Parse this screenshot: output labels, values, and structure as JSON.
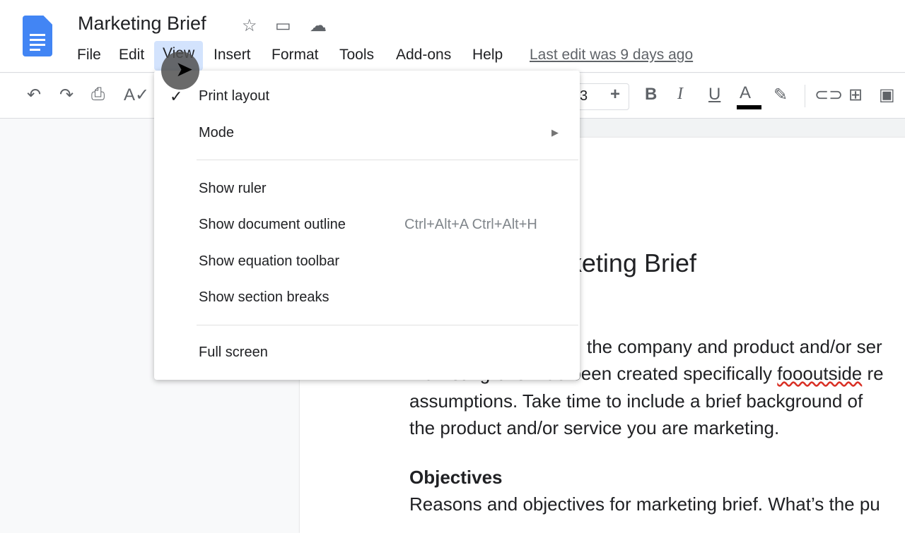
{
  "header": {
    "title": "Marketing Brief",
    "icons": [
      "star-icon",
      "move-to-folder-icon",
      "cloud-saved-icon"
    ],
    "menus": [
      "File",
      "Edit",
      "View",
      "Insert",
      "Format",
      "Tools",
      "Add-ons",
      "Help"
    ],
    "last_edit": "Last edit was 9 days ago"
  },
  "toolbar": {
    "font_size": "3",
    "increase": "+",
    "bold": "B",
    "italic": "I",
    "underline": "U",
    "text_color": "A",
    "text_color_value": "#000000"
  },
  "view_menu": {
    "items": [
      {
        "label": "Print layout",
        "checked": true
      },
      {
        "label": "Mode",
        "submenu": true
      },
      {
        "label": "Show ruler"
      },
      {
        "label": "Show document outline",
        "shortcut": "Ctrl+Alt+A Ctrl+Alt+H"
      },
      {
        "label": "Show equation toolbar"
      },
      {
        "label": "Show section breaks"
      },
      {
        "label": "Full screen"
      }
    ]
  },
  "document": {
    "title": "Marketing Brief",
    "lines": [
      "the company and product and/or ser",
      "marketing brief has been created specifically ",
      "foooutside",
      " re",
      "assumptions. Take time to include a brief background of",
      "the product and/or service you are marketing."
    ],
    "heading": "Objectives",
    "last_line": "Reasons and objectives for marketing brief. What’s the pu"
  }
}
